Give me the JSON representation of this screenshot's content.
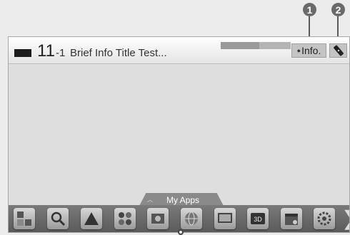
{
  "callouts": [
    "1",
    "2"
  ],
  "info_bar": {
    "channel_number": "11",
    "channel_sub": "-1",
    "program_title": "Brief Info Title Test...",
    "progress": 0.55,
    "info_label": "Info."
  },
  "apps": {
    "tab_label": "My Apps",
    "icons": [
      "channel-list",
      "search",
      "store",
      "media-grid",
      "photo",
      "globe",
      "tv-guide",
      "3d",
      "schedule",
      "settings"
    ],
    "more_glyph": "❯"
  }
}
